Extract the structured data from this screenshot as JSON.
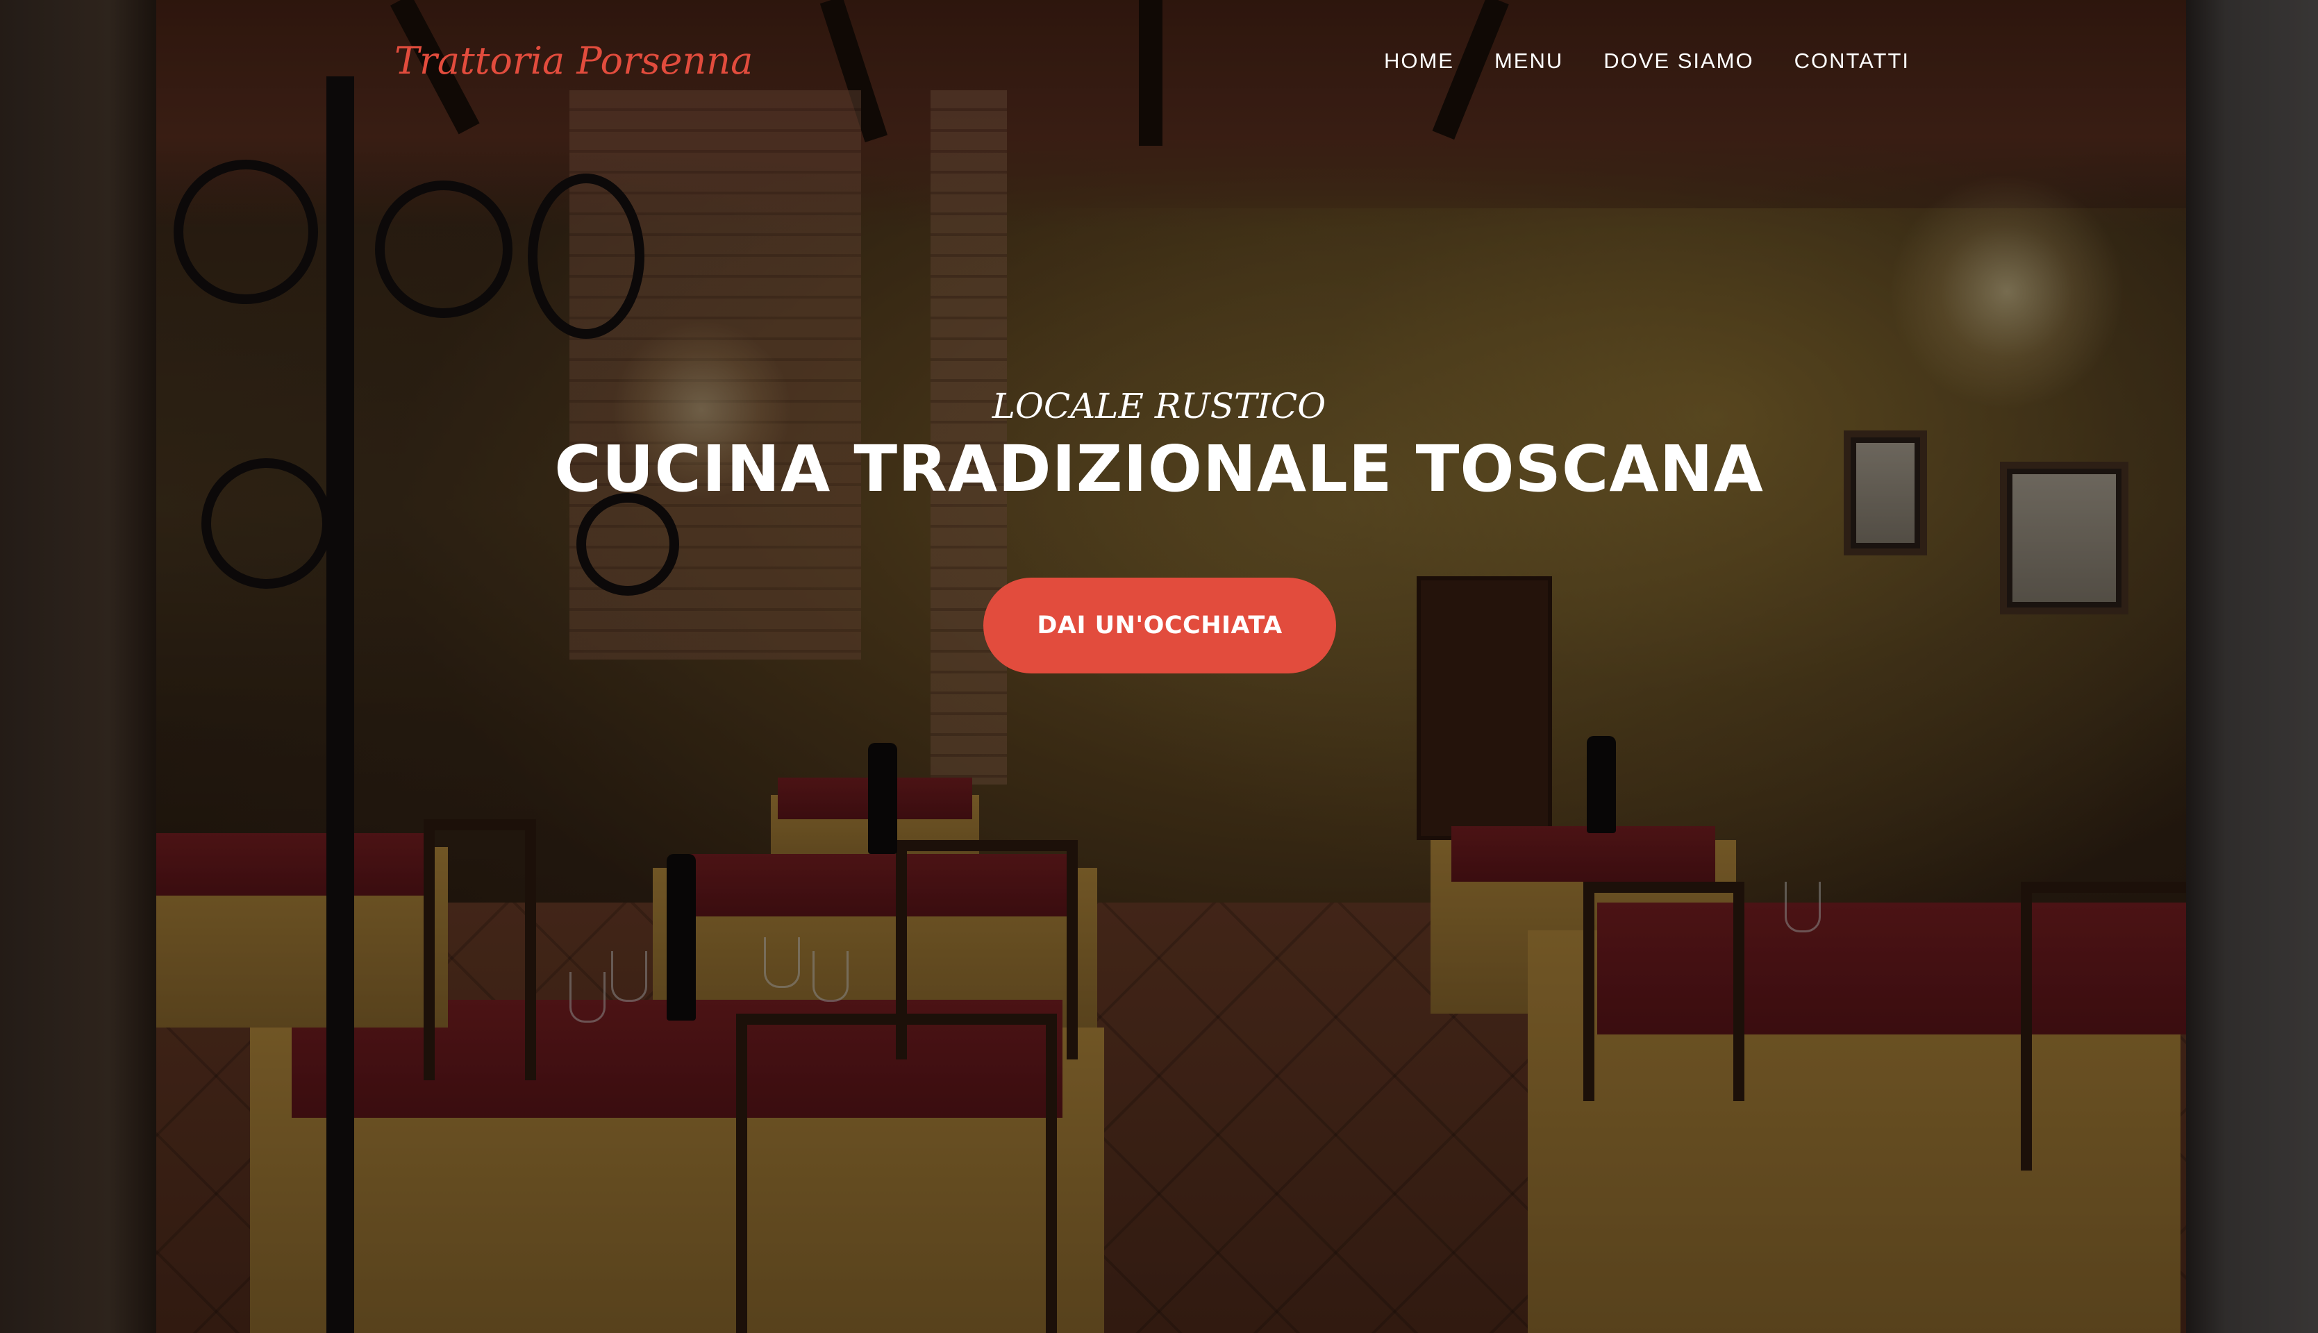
{
  "header": {
    "brand": "Trattoria Porsenna",
    "nav": [
      {
        "label": "HOME"
      },
      {
        "label": "MENU"
      },
      {
        "label": "DOVE SIAMO"
      },
      {
        "label": "CONTATTI"
      }
    ]
  },
  "hero": {
    "subtitle": "LOCALE RUSTICO",
    "title": "CUCINA TRADIZIONALE TOSCANA",
    "cta_label": "DAI UN'OCCHIATA",
    "background_image": "restaurant-interior-photo"
  },
  "colors": {
    "accent": "#e24c3d",
    "text": "#ffffff"
  }
}
